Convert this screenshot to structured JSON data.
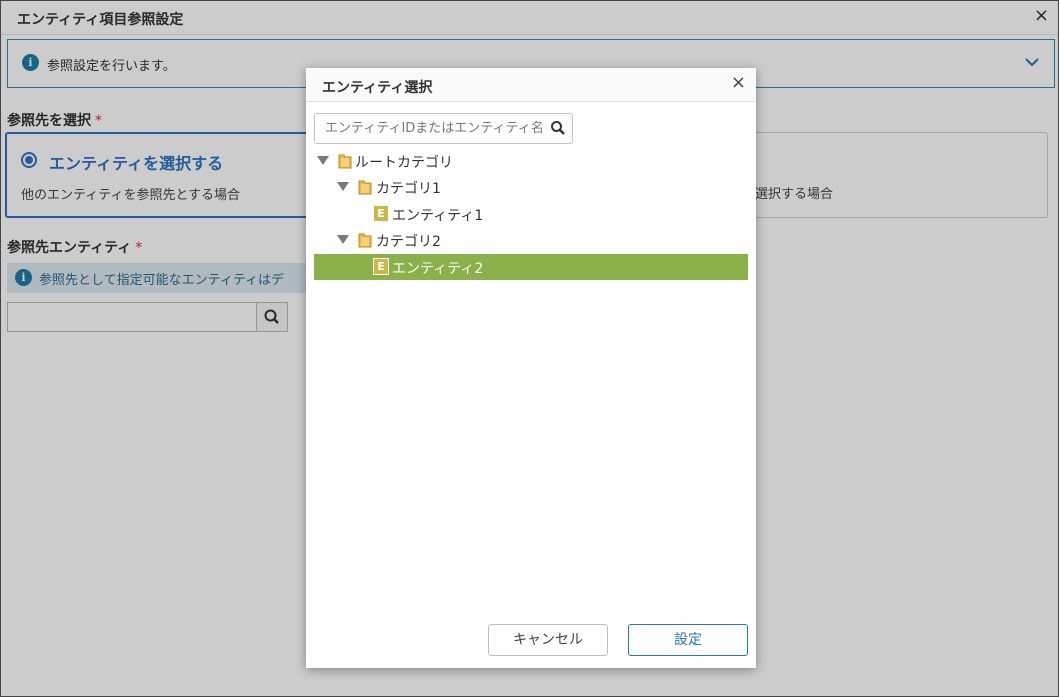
{
  "window": {
    "title": "エンティティ項目参照設定",
    "close_icon": "×"
  },
  "info": {
    "text": "参照設定を行います。",
    "icon": "i"
  },
  "reference_target": {
    "label": "参照先を選択",
    "required_mark": "*",
    "option_entity": {
      "title": "エンティティを選択する",
      "description": "他のエンティティを参照先とする場合"
    },
    "option_other": {
      "description": "選択する場合"
    }
  },
  "reference_entity": {
    "label": "参照先エンティティ",
    "required_mark": "*",
    "hint": "参照先として指定可能なエンティティはデ",
    "input_value": ""
  },
  "modal": {
    "title": "エンティティ選択",
    "close_icon": "×",
    "search_placeholder": "エンティティIDまたはエンティティ名",
    "tree": [
      {
        "label": "ルートカテゴリ",
        "type": "folder",
        "expanded": true,
        "level": 0
      },
      {
        "label": "カテゴリ1",
        "type": "folder",
        "expanded": true,
        "level": 1
      },
      {
        "label": "エンティティ1",
        "type": "entity",
        "level": 2,
        "icon": "E"
      },
      {
        "label": "カテゴリ2",
        "type": "folder",
        "expanded": true,
        "level": 1
      },
      {
        "label": "エンティティ2",
        "type": "entity",
        "level": 2,
        "icon": "E",
        "selected": true
      }
    ],
    "cancel_label": "キャンセル",
    "ok_label": "設定"
  },
  "colors": {
    "accent": "#2d73c4",
    "selected_row": "#8ab14a",
    "info": "#1f7ea8"
  }
}
